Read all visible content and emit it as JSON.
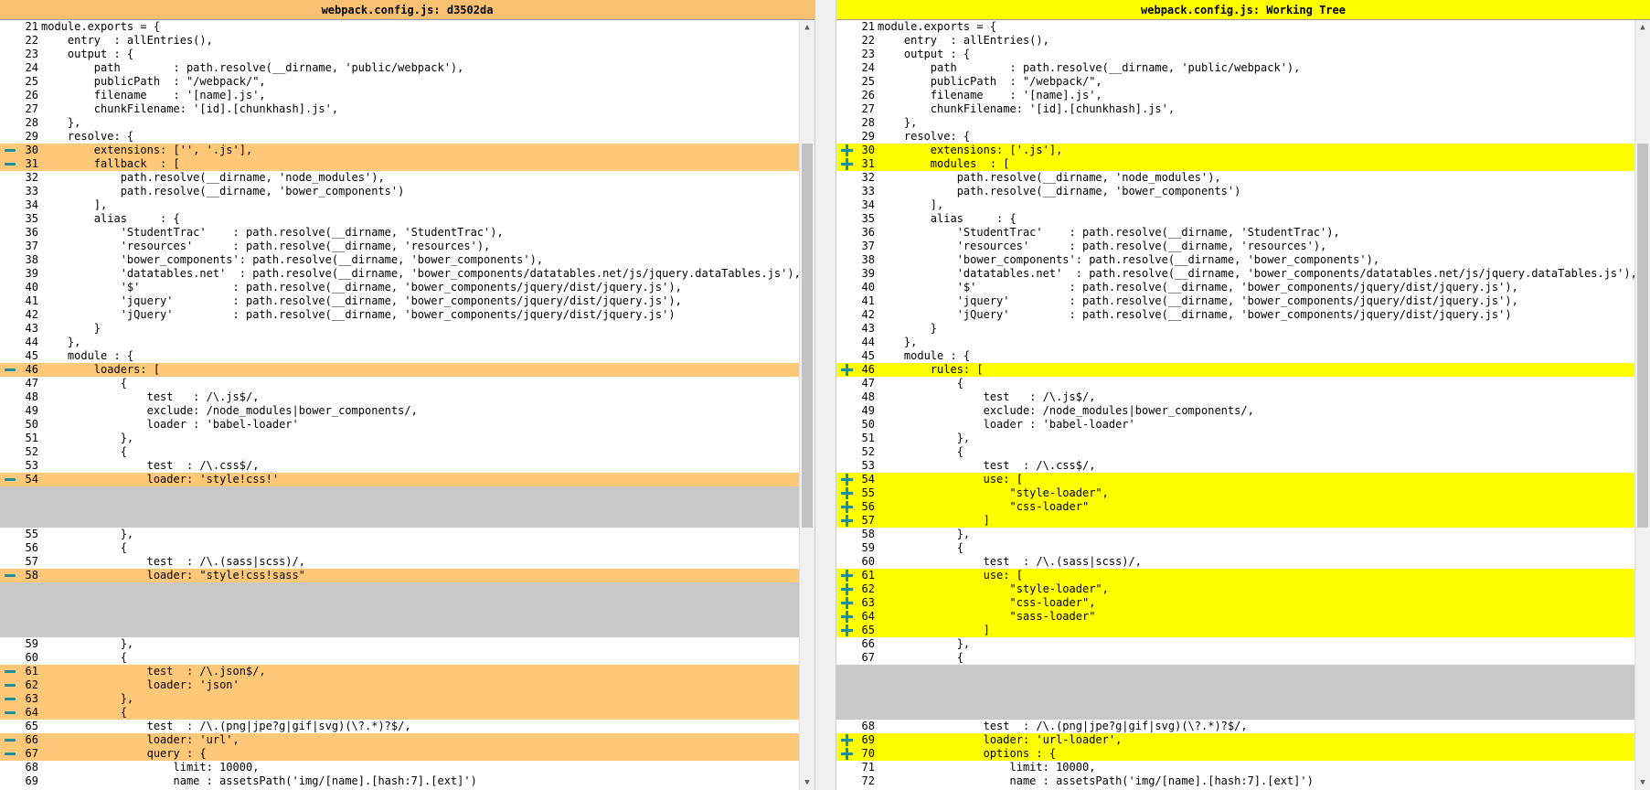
{
  "left": {
    "title": "webpack.config.js: d3502da",
    "lines": [
      {
        "n": "21",
        "t": "module.exports = {",
        "k": ""
      },
      {
        "n": "22",
        "t": "    entry  : allEntries(),",
        "k": ""
      },
      {
        "n": "23",
        "t": "    output : {",
        "k": ""
      },
      {
        "n": "24",
        "t": "        path        : path.resolve(__dirname, 'public/webpack'),",
        "k": ""
      },
      {
        "n": "25",
        "t": "        publicPath  : \"/webpack/\",",
        "k": ""
      },
      {
        "n": "26",
        "t": "        filename    : '[name].js',",
        "k": ""
      },
      {
        "n": "27",
        "t": "        chunkFilename: '[id].[chunkhash].js',",
        "k": ""
      },
      {
        "n": "28",
        "t": "    },",
        "k": ""
      },
      {
        "n": "29",
        "t": "    resolve: {",
        "k": ""
      },
      {
        "n": "30",
        "t": "        extensions: ['', '.js'],",
        "k": "chg"
      },
      {
        "n": "31",
        "t": "        fallback  : [",
        "k": "chg"
      },
      {
        "n": "32",
        "t": "            path.resolve(__dirname, 'node_modules'),",
        "k": ""
      },
      {
        "n": "33",
        "t": "            path.resolve(__dirname, 'bower_components')",
        "k": ""
      },
      {
        "n": "34",
        "t": "        ],",
        "k": ""
      },
      {
        "n": "35",
        "t": "        alias     : {",
        "k": ""
      },
      {
        "n": "36",
        "t": "            'StudentTrac'    : path.resolve(__dirname, 'StudentTrac'),",
        "k": ""
      },
      {
        "n": "37",
        "t": "            'resources'      : path.resolve(__dirname, 'resources'),",
        "k": ""
      },
      {
        "n": "38",
        "t": "            'bower_components': path.resolve(__dirname, 'bower_components'),",
        "k": ""
      },
      {
        "n": "39",
        "t": "            'datatables.net'  : path.resolve(__dirname, 'bower_components/datatables.net/js/jquery.dataTables.js'),",
        "k": ""
      },
      {
        "n": "40",
        "t": "            '$'              : path.resolve(__dirname, 'bower_components/jquery/dist/jquery.js'),",
        "k": ""
      },
      {
        "n": "41",
        "t": "            'jquery'         : path.resolve(__dirname, 'bower_components/jquery/dist/jquery.js'),",
        "k": ""
      },
      {
        "n": "42",
        "t": "            'jQuery'         : path.resolve(__dirname, 'bower_components/jquery/dist/jquery.js')",
        "k": ""
      },
      {
        "n": "43",
        "t": "        }",
        "k": ""
      },
      {
        "n": "44",
        "t": "    },",
        "k": ""
      },
      {
        "n": "45",
        "t": "    module : {",
        "k": ""
      },
      {
        "n": "46",
        "t": "        loaders: [",
        "k": "chg"
      },
      {
        "n": "47",
        "t": "            {",
        "k": ""
      },
      {
        "n": "48",
        "t": "                test   : /\\.js$/,",
        "k": ""
      },
      {
        "n": "49",
        "t": "                exclude: /node_modules|bower_components/,",
        "k": ""
      },
      {
        "n": "50",
        "t": "                loader : 'babel-loader'",
        "k": ""
      },
      {
        "n": "51",
        "t": "            },",
        "k": ""
      },
      {
        "n": "52",
        "t": "            {",
        "k": ""
      },
      {
        "n": "53",
        "t": "                test  : /\\.css$/,",
        "k": ""
      },
      {
        "n": "54",
        "t": "                loader: 'style!css!'",
        "k": "chg"
      },
      {
        "n": "",
        "t": "",
        "k": "fill"
      },
      {
        "n": "",
        "t": "",
        "k": "fill"
      },
      {
        "n": "",
        "t": "",
        "k": "fill"
      },
      {
        "n": "55",
        "t": "            },",
        "k": ""
      },
      {
        "n": "56",
        "t": "            {",
        "k": ""
      },
      {
        "n": "57",
        "t": "                test  : /\\.(sass|scss)/,",
        "k": ""
      },
      {
        "n": "58",
        "t": "                loader: \"style!css!sass\"",
        "k": "chg"
      },
      {
        "n": "",
        "t": "",
        "k": "fill"
      },
      {
        "n": "",
        "t": "",
        "k": "fill"
      },
      {
        "n": "",
        "t": "",
        "k": "fill"
      },
      {
        "n": "",
        "t": "",
        "k": "fill"
      },
      {
        "n": "59",
        "t": "            },",
        "k": ""
      },
      {
        "n": "60",
        "t": "            {",
        "k": ""
      },
      {
        "n": "61",
        "t": "                test  : /\\.json$/,",
        "k": "chg"
      },
      {
        "n": "62",
        "t": "                loader: 'json'",
        "k": "chg"
      },
      {
        "n": "63",
        "t": "            },",
        "k": "chg"
      },
      {
        "n": "64",
        "t": "            {",
        "k": "chg"
      },
      {
        "n": "65",
        "t": "                test  : /\\.(png|jpe?g|gif|svg)(\\?.*)?$/,",
        "k": ""
      },
      {
        "n": "66",
        "t": "                loader: 'url',",
        "k": "chg"
      },
      {
        "n": "67",
        "t": "                query : {",
        "k": "chg"
      },
      {
        "n": "68",
        "t": "                    limit: 10000,",
        "k": ""
      },
      {
        "n": "69",
        "t": "                    name : assetsPath('img/[name].[hash:7].[ext]')",
        "k": ""
      }
    ]
  },
  "right": {
    "title": "webpack.config.js: Working Tree",
    "lines": [
      {
        "n": "21",
        "t": "module.exports = {",
        "k": ""
      },
      {
        "n": "22",
        "t": "    entry  : allEntries(),",
        "k": ""
      },
      {
        "n": "23",
        "t": "    output : {",
        "k": ""
      },
      {
        "n": "24",
        "t": "        path        : path.resolve(__dirname, 'public/webpack'),",
        "k": ""
      },
      {
        "n": "25",
        "t": "        publicPath  : \"/webpack/\",",
        "k": ""
      },
      {
        "n": "26",
        "t": "        filename    : '[name].js',",
        "k": ""
      },
      {
        "n": "27",
        "t": "        chunkFilename: '[id].[chunkhash].js',",
        "k": ""
      },
      {
        "n": "28",
        "t": "    },",
        "k": ""
      },
      {
        "n": "29",
        "t": "    resolve: {",
        "k": ""
      },
      {
        "n": "30",
        "t": "        extensions: ['.js'],",
        "k": "chg"
      },
      {
        "n": "31",
        "t": "        modules  : [",
        "k": "chg"
      },
      {
        "n": "32",
        "t": "            path.resolve(__dirname, 'node_modules'),",
        "k": ""
      },
      {
        "n": "33",
        "t": "            path.resolve(__dirname, 'bower_components')",
        "k": ""
      },
      {
        "n": "34",
        "t": "        ],",
        "k": ""
      },
      {
        "n": "35",
        "t": "        alias     : {",
        "k": ""
      },
      {
        "n": "36",
        "t": "            'StudentTrac'    : path.resolve(__dirname, 'StudentTrac'),",
        "k": ""
      },
      {
        "n": "37",
        "t": "            'resources'      : path.resolve(__dirname, 'resources'),",
        "k": ""
      },
      {
        "n": "38",
        "t": "            'bower_components': path.resolve(__dirname, 'bower_components'),",
        "k": ""
      },
      {
        "n": "39",
        "t": "            'datatables.net'  : path.resolve(__dirname, 'bower_components/datatables.net/js/jquery.dataTables.js'),",
        "k": ""
      },
      {
        "n": "40",
        "t": "            '$'              : path.resolve(__dirname, 'bower_components/jquery/dist/jquery.js'),",
        "k": ""
      },
      {
        "n": "41",
        "t": "            'jquery'         : path.resolve(__dirname, 'bower_components/jquery/dist/jquery.js'),",
        "k": ""
      },
      {
        "n": "42",
        "t": "            'jQuery'         : path.resolve(__dirname, 'bower_components/jquery/dist/jquery.js')",
        "k": ""
      },
      {
        "n": "43",
        "t": "        }",
        "k": ""
      },
      {
        "n": "44",
        "t": "    },",
        "k": ""
      },
      {
        "n": "45",
        "t": "    module : {",
        "k": ""
      },
      {
        "n": "46",
        "t": "        rules: [",
        "k": "chg"
      },
      {
        "n": "47",
        "t": "            {",
        "k": ""
      },
      {
        "n": "48",
        "t": "                test   : /\\.js$/,",
        "k": ""
      },
      {
        "n": "49",
        "t": "                exclude: /node_modules|bower_components/,",
        "k": ""
      },
      {
        "n": "50",
        "t": "                loader : 'babel-loader'",
        "k": ""
      },
      {
        "n": "51",
        "t": "            },",
        "k": ""
      },
      {
        "n": "52",
        "t": "            {",
        "k": ""
      },
      {
        "n": "53",
        "t": "                test  : /\\.css$/,",
        "k": ""
      },
      {
        "n": "54",
        "t": "                use: [",
        "k": "chg"
      },
      {
        "n": "55",
        "t": "                    \"style-loader\",",
        "k": "chg"
      },
      {
        "n": "56",
        "t": "                    \"css-loader\"",
        "k": "chg"
      },
      {
        "n": "57",
        "t": "                ]",
        "k": "chg"
      },
      {
        "n": "58",
        "t": "            },",
        "k": ""
      },
      {
        "n": "59",
        "t": "            {",
        "k": ""
      },
      {
        "n": "60",
        "t": "                test  : /\\.(sass|scss)/,",
        "k": ""
      },
      {
        "n": "61",
        "t": "                use: [",
        "k": "chg"
      },
      {
        "n": "62",
        "t": "                    \"style-loader\",",
        "k": "chg"
      },
      {
        "n": "63",
        "t": "                    \"css-loader\",",
        "k": "chg"
      },
      {
        "n": "64",
        "t": "                    \"sass-loader\"",
        "k": "chg"
      },
      {
        "n": "65",
        "t": "                ]",
        "k": "chg"
      },
      {
        "n": "66",
        "t": "            },",
        "k": ""
      },
      {
        "n": "67",
        "t": "            {",
        "k": ""
      },
      {
        "n": "",
        "t": "",
        "k": "fill"
      },
      {
        "n": "",
        "t": "",
        "k": "fill"
      },
      {
        "n": "",
        "t": "",
        "k": "fill"
      },
      {
        "n": "",
        "t": "",
        "k": "fill"
      },
      {
        "n": "68",
        "t": "                test  : /\\.(png|jpe?g|gif|svg)(\\?.*)?$/,",
        "k": ""
      },
      {
        "n": "69",
        "t": "                loader: 'url-loader',",
        "k": "chg"
      },
      {
        "n": "70",
        "t": "                options : {",
        "k": "chg"
      },
      {
        "n": "71",
        "t": "                    limit: 10000,",
        "k": ""
      },
      {
        "n": "72",
        "t": "                    name : assetsPath('img/[name].[hash:7].[ext]')",
        "k": ""
      }
    ]
  },
  "icons": {
    "left_change_marker": "minus-icon",
    "right_change_marker": "plus-icon"
  },
  "colors": {
    "left_header": "#f8c070",
    "right_header": "#ffff00",
    "left_changed": "#ffc878",
    "right_changed": "#ffff00",
    "filler": "#c8c8c8",
    "word_removed": "#d07070",
    "marker": "#1a8fa0"
  }
}
